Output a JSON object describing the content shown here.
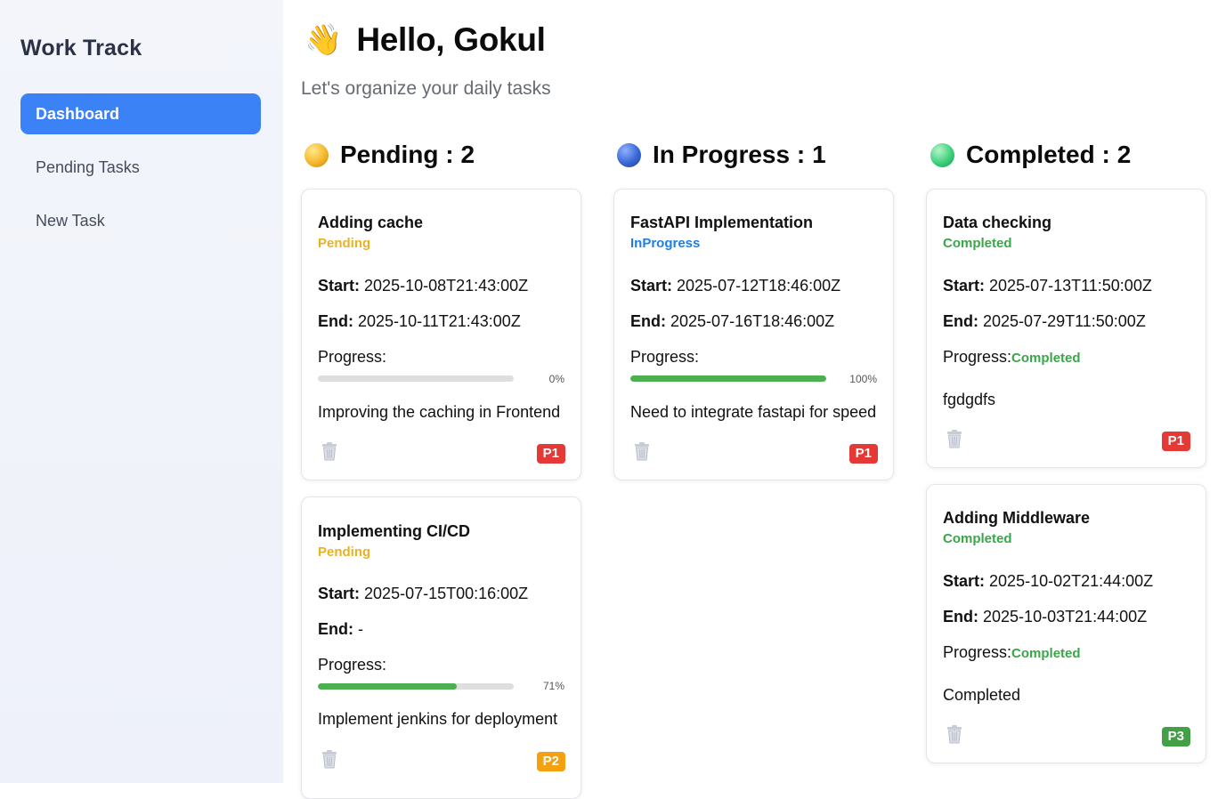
{
  "sidebar": {
    "brand": "Work Track",
    "items": [
      {
        "label": "Dashboard",
        "active": true
      },
      {
        "label": "Pending Tasks",
        "active": false
      },
      {
        "label": "New Task",
        "active": false
      }
    ]
  },
  "header": {
    "wave_icon": "👋",
    "greeting": "Hello, Gokul",
    "subtitle": "Let's organize your daily tasks"
  },
  "columns": {
    "pending": {
      "label": "Pending :",
      "count": "2",
      "dot_color": "#f4b72b"
    },
    "inprogress": {
      "label": "In Progress :",
      "count": "1",
      "dot_color": "#3a66d6"
    },
    "completed": {
      "label": "Completed :",
      "count": "2",
      "dot_color": "#3fd07d"
    }
  },
  "labels": {
    "start": "Start:",
    "end": "End:",
    "progress": "Progress:"
  },
  "cards": {
    "c1": {
      "title": "Adding cache",
      "status": "Pending",
      "start": "2025-10-08T21:43:00Z",
      "end": "2025-10-11T21:43:00Z",
      "progress_fraction": 0,
      "progress_text": "0%",
      "description": "Improving the caching in Frontend",
      "priority": "P1"
    },
    "c2": {
      "title": "Implementing CI/CD",
      "status": "Pending",
      "start": "2025-07-15T00:16:00Z",
      "end": "-",
      "progress_fraction": 0.71,
      "progress_text": "71%",
      "description": "Implement jenkins for deployment",
      "priority": "P2"
    },
    "c3": {
      "title": "FastAPI Implementation",
      "status": "InProgress",
      "start": "2025-07-12T18:46:00Z",
      "end": "2025-07-16T18:46:00Z",
      "progress_fraction": 1,
      "progress_text": "100%",
      "description": "Need to integrate fastapi for speed",
      "priority": "P1"
    },
    "c4": {
      "title": "Data checking",
      "status": "Completed",
      "start": "2025-07-13T11:50:00Z",
      "end": "2025-07-29T11:50:00Z",
      "progress_status": "Completed",
      "description": "fgdgdfs",
      "priority": "P1"
    },
    "c5": {
      "title": "Adding Middleware",
      "status": "Completed",
      "start": "2025-10-02T21:44:00Z",
      "end": "2025-10-03T21:44:00Z",
      "progress_status": "Completed",
      "description": "Completed",
      "priority": "P3"
    }
  },
  "colors": {
    "accent": "#3b82f6",
    "pending": "#e8b323",
    "inprogress": "#1d7fe8",
    "completed": "#3aa64a",
    "p1": "#e53935",
    "p2": "#f5a00f",
    "p3": "#43a047",
    "progress_fill": "#4caf50"
  }
}
